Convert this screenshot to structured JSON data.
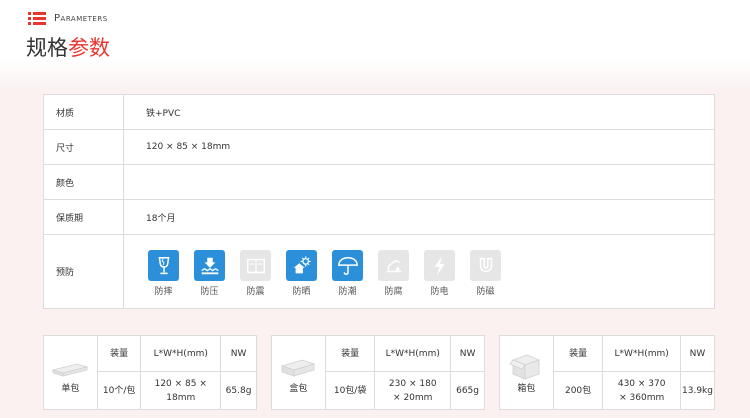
{
  "header": {
    "subtitle": "Parameters",
    "title_part1": "规格",
    "title_part2": "参数"
  },
  "colors": {
    "accent": "#e8352f",
    "icon_active": "#2b90d9",
    "icon_inactive": "#e6e6e6"
  },
  "params": {
    "material": {
      "label": "材质",
      "value": "铁+PVC"
    },
    "size": {
      "label": "尺寸",
      "value": "120 × 85 × 18mm"
    },
    "color": {
      "label": "颜色",
      "value": ""
    },
    "shelf_life": {
      "label": "保质期",
      "value": "18个月"
    },
    "prevent": {
      "label": "预防",
      "items": [
        {
          "label": "防摔",
          "icon": "fragile-glass-icon",
          "active": true
        },
        {
          "label": "防压",
          "icon": "no-stack-press-icon",
          "active": true
        },
        {
          "label": "防震",
          "icon": "shockproof-icon",
          "active": false
        },
        {
          "label": "防晒",
          "icon": "sun-protect-icon",
          "active": true
        },
        {
          "label": "防潮",
          "icon": "umbrella-moisture-icon",
          "active": true
        },
        {
          "label": "防腐",
          "icon": "anti-corrosion-icon",
          "active": false
        },
        {
          "label": "防电",
          "icon": "lightning-icon",
          "active": false
        },
        {
          "label": "防磁",
          "icon": "magnet-icon",
          "active": false
        }
      ]
    }
  },
  "packaging": {
    "columns": [
      "装量",
      "L*W*H(mm)",
      "NW"
    ],
    "single": {
      "name": "单包",
      "qty": "10个/包",
      "dims": "120 × 85 × 18mm",
      "nw": "65.8g"
    },
    "box": {
      "name": "盒包",
      "qty": "10包/袋",
      "dims": "230 × 180 × 20mm",
      "nw": "665g"
    },
    "carton": {
      "name": "箱包",
      "qty": "200包",
      "dims": "430 × 370 × 360mm",
      "nw": "13.9kg"
    }
  }
}
